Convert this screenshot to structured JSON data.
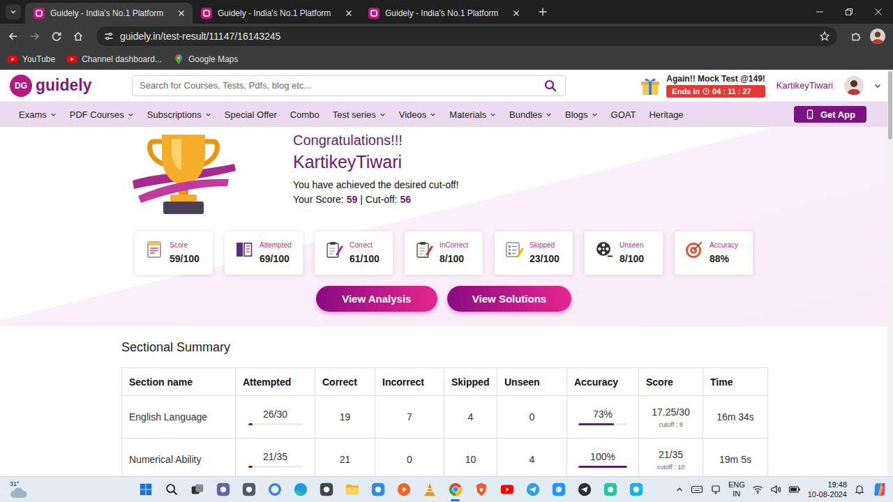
{
  "browser": {
    "tabs": [
      {
        "label": "Guidely - India's No.1 Platform",
        "selected": true
      },
      {
        "label": "Guidely - India's No.1 Platform",
        "selected": false
      },
      {
        "label": "Guidely - India's No.1 Platform",
        "selected": false
      }
    ],
    "back_enabled": true,
    "forward_enabled": false,
    "address": "guidely.in/test-result/11147/16143245",
    "bookmarks": [
      {
        "label": "YouTube"
      },
      {
        "label": "Channel dashboard..."
      },
      {
        "label": "Google Maps"
      }
    ]
  },
  "header": {
    "logo_mark": "DG",
    "logo": "guidely",
    "search_placeholder": "Search for Courses, Tests, Pdfs, blog etc...",
    "promo_title": "Again!! Mock Test @149!",
    "promo_label": "Ends in",
    "promo_timer": "04 : 11 : 27",
    "user": "KartikeyTiwari"
  },
  "nav": {
    "items": [
      {
        "label": "Exams",
        "dropdown": true
      },
      {
        "label": "PDF Courses",
        "dropdown": true
      },
      {
        "label": "Subscriptions",
        "dropdown": true
      },
      {
        "label": "Special Offer",
        "dropdown": false
      },
      {
        "label": "Combo",
        "dropdown": false
      },
      {
        "label": "Test series",
        "dropdown": true
      },
      {
        "label": "Videos",
        "dropdown": true
      },
      {
        "label": "Materials",
        "dropdown": true
      },
      {
        "label": "Bundles",
        "dropdown": true
      },
      {
        "label": "Blogs",
        "dropdown": true
      },
      {
        "label": "GOAT",
        "dropdown": false
      },
      {
        "label": "Heritage",
        "dropdown": false
      }
    ],
    "get_app": "Get App"
  },
  "result": {
    "heading": "Congratulations!!!",
    "name": "KartikeyTiwari",
    "message": "You have achieved the desired cut-off!",
    "score_label": "Your Score:",
    "score": "59",
    "separator": "|",
    "cutoff_label": "Cut-off:",
    "cutoff": "56"
  },
  "stats": [
    {
      "label": "Score",
      "value": "59",
      "total": "/100"
    },
    {
      "label": "Attempted",
      "value": "69",
      "total": "/100"
    },
    {
      "label": "Correct",
      "value": "61",
      "total": "/100"
    },
    {
      "label": "InCorrect",
      "value": "8",
      "total": "/100"
    },
    {
      "label": "Skipped",
      "value": "23",
      "total": "/100"
    },
    {
      "label": "Unseen",
      "value": "8",
      "total": "/100"
    },
    {
      "label": "Accuracy",
      "value": "88%"
    }
  ],
  "actions": [
    "View Analysis",
    "View Solutions"
  ],
  "summary": {
    "title": "Sectional Summary",
    "columns": [
      "Section name",
      "Attempted",
      "Correct",
      "Incorrect",
      "Skipped",
      "Unseen",
      "Accuracy",
      "Score",
      "Time"
    ],
    "rows": [
      {
        "section": "English Language",
        "attempted": "26/30",
        "attempted_level": 0.08,
        "correct": "19",
        "incorrect": "7",
        "skipped": "4",
        "unseen": "0",
        "accuracy": "73%",
        "accuracy_level": 0.73,
        "score": "17.25/30",
        "cutoff": "cutoff : 8",
        "time": "16m 34s"
      },
      {
        "section": "Numerical Ability",
        "attempted": "21/35",
        "attempted_level": 0.08,
        "correct": "21",
        "incorrect": "0",
        "skipped": "10",
        "unseen": "4",
        "accuracy": "100%",
        "accuracy_level": 1.0,
        "score": "21/35",
        "cutoff": "cutoff : 10",
        "time": "19m 5s"
      }
    ]
  },
  "taskbar": {
    "temperature": "31°",
    "apps": [
      {
        "active": false
      },
      {
        "active": false
      },
      {
        "active": false
      },
      {
        "active": false
      },
      {
        "active": false
      },
      {
        "active": false
      },
      {
        "active": false
      },
      {
        "active": false
      },
      {
        "active": false
      },
      {
        "active": false
      },
      {
        "active": false
      },
      {
        "active": false
      },
      {
        "active": true
      },
      {
        "active": false
      },
      {
        "active": false
      },
      {
        "active": false
      },
      {
        "active": false
      },
      {
        "active": false
      },
      {
        "active": false
      },
      {
        "active": false
      }
    ],
    "language": "ENG",
    "region": "IN",
    "time": "19:48",
    "date": "10-08-2024"
  }
}
